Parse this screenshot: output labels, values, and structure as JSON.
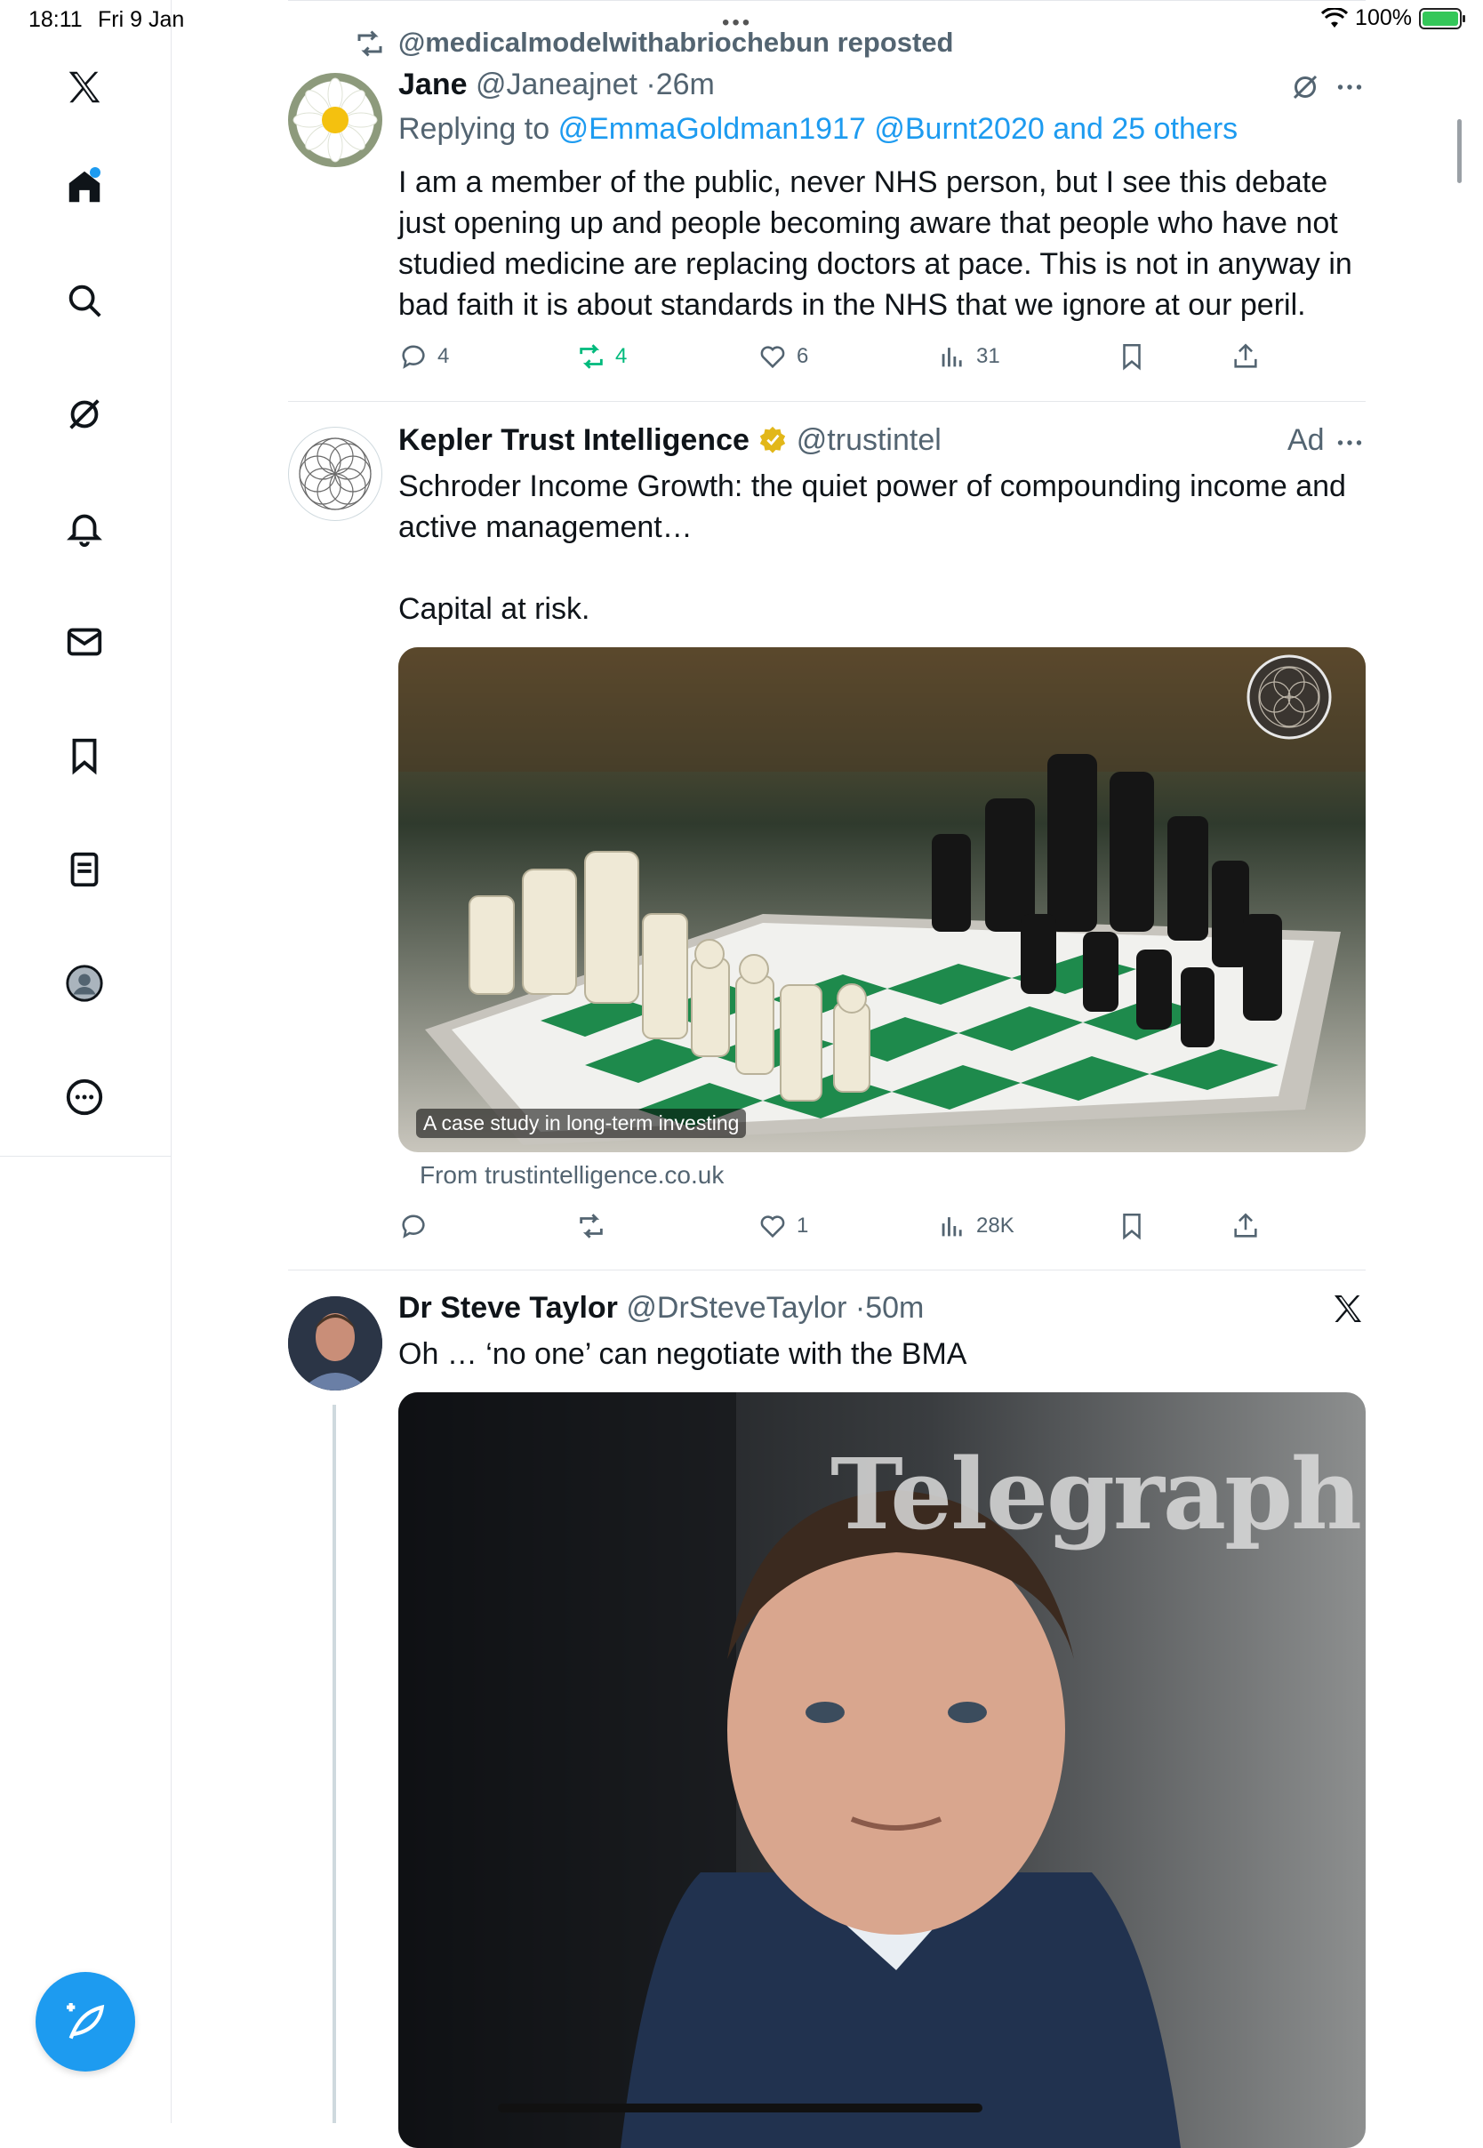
{
  "status": {
    "time": "18:11",
    "date": "Fri 9 Jan",
    "battery": "100%"
  },
  "sidebar": {
    "items": [
      {
        "name": "logo"
      },
      {
        "name": "home"
      },
      {
        "name": "search"
      },
      {
        "name": "grok"
      },
      {
        "name": "notifications"
      },
      {
        "name": "messages"
      },
      {
        "name": "bookmarks"
      },
      {
        "name": "lists"
      },
      {
        "name": "profile"
      },
      {
        "name": "more"
      }
    ]
  },
  "feed": {
    "repost_banner": "@medicalmodelwithabriochebun reposted",
    "tweets": [
      {
        "name": "Jane",
        "handle": "@Janeajnet",
        "time": "26m",
        "replying_prefix": "Replying to",
        "replying_to": "@EmmaGoldman1917 @Burnt2020 and 25 others",
        "text": "I am a member of the public, never NHS person, but I see this debate just opening up and people becoming aware that people who have not studied medicine are replacing doctors at pace. This is not in anyway in bad faith it is about standards in the NHS that we ignore at our peril.",
        "replies": "4",
        "reposts": "4",
        "likes": "6",
        "views": "31"
      },
      {
        "name": "Kepler Trust Intelligence",
        "handle": "@trustintel",
        "ad_label": "Ad",
        "text_line1": "Schroder Income Growth: the quiet power of compounding income and active management…",
        "text_line2": "Capital at risk.",
        "image_caption": "A case study in long-term investing",
        "from": "From trustintelligence.co.uk",
        "likes": "1",
        "views": "28K"
      },
      {
        "name": "Dr Steve Taylor",
        "handle": "@DrSteveTaylor",
        "time": "50m",
        "text": "Oh … ‘no one’ can negotiate with the BMA",
        "image_watermark": "Telegraph"
      }
    ]
  }
}
